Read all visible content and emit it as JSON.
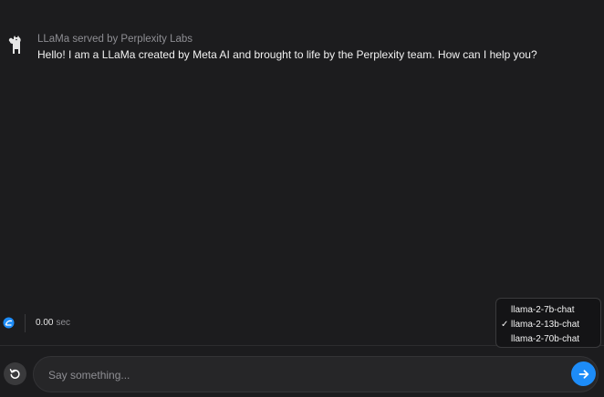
{
  "message": {
    "sender": "LLaMa served by Perplexity Labs",
    "text": "Hello! I am a LLaMa created by Meta AI and brought to life by the Perplexity team. How can I help you?",
    "avatar_icon": "llama-icon"
  },
  "status": {
    "icon": "perplexity-icon",
    "latency_value": "0.00",
    "latency_unit": "sec"
  },
  "model_menu": {
    "items": [
      {
        "label": "llama-2-7b-chat",
        "selected": false
      },
      {
        "label": "llama-2-13b-chat",
        "selected": true
      },
      {
        "label": "llama-2-70b-chat",
        "selected": false
      }
    ],
    "check_mark": "✓"
  },
  "composer": {
    "placeholder": "Say something...",
    "reset_icon": "rotate-ccw-icon",
    "send_icon": "arrow-right-icon"
  },
  "colors": {
    "background": "#1c1c1e",
    "accent": "#1d8cf8"
  }
}
